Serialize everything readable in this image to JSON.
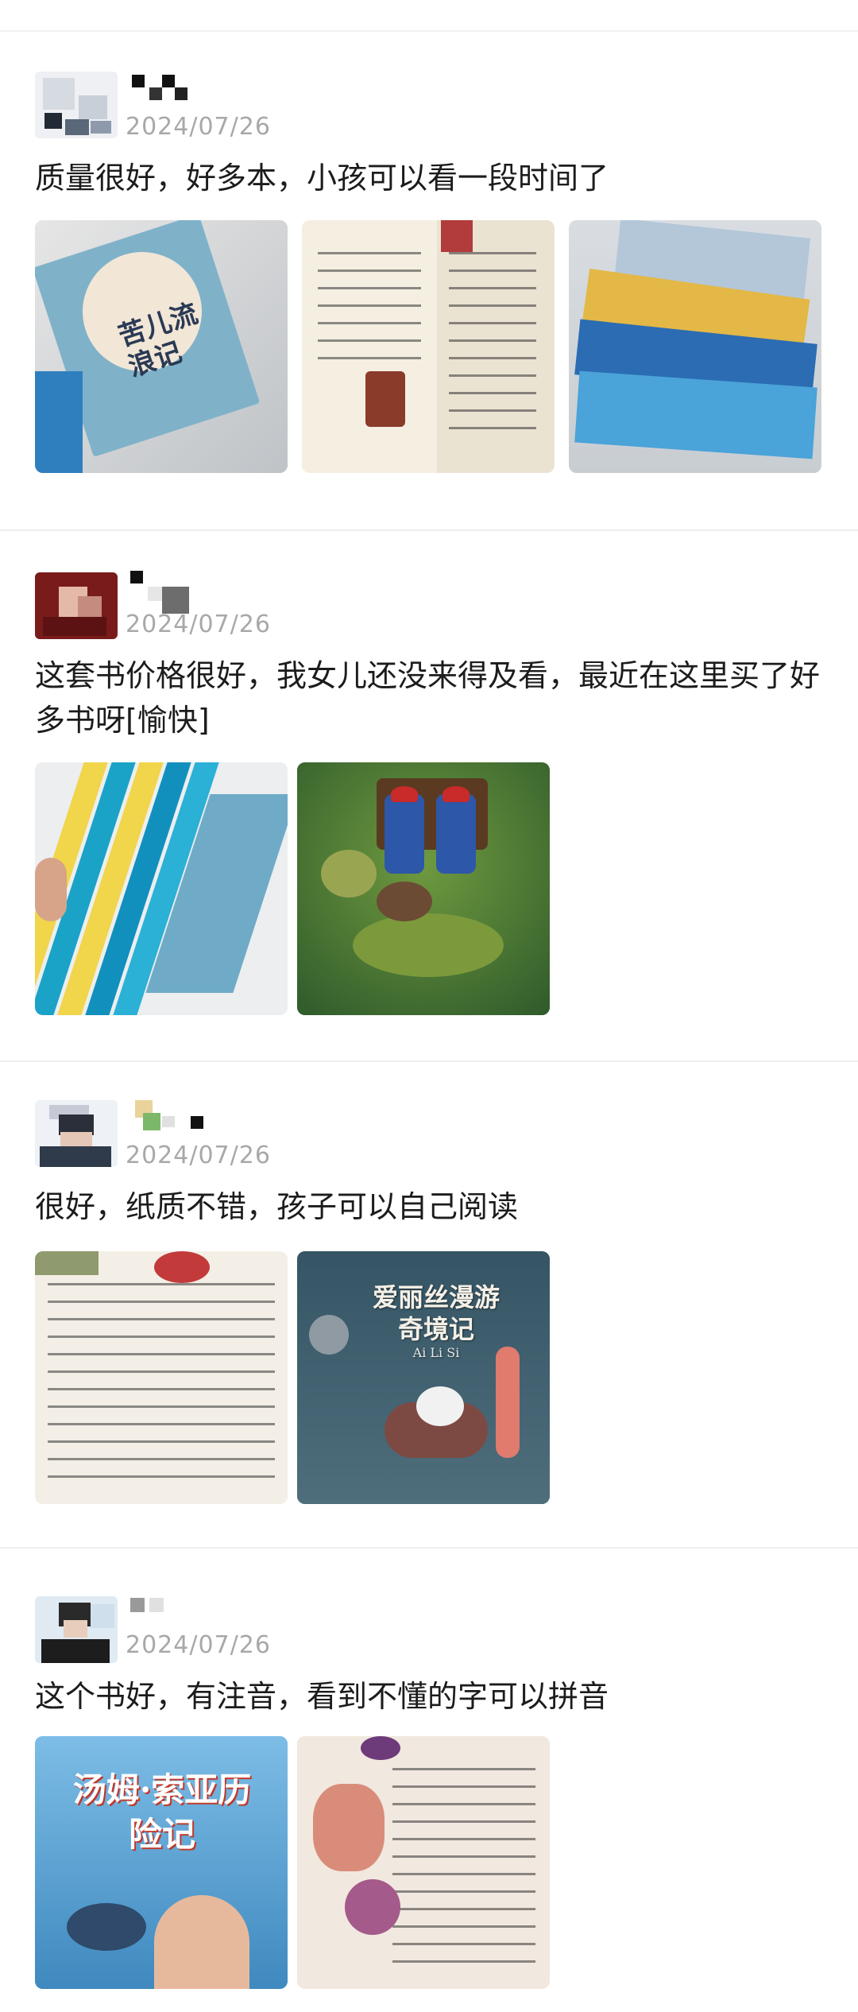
{
  "reviews": [
    {
      "date": "2024/07/26",
      "text": "质量很好，好多本，小孩可以看一段时间了",
      "photos": [
        {
          "alt": "photo",
          "title": "苦儿流浪记"
        },
        {
          "alt": "photo",
          "title": ""
        },
        {
          "alt": "photo",
          "title": ""
        }
      ]
    },
    {
      "date": "2024/07/26",
      "text": "这套书价格很好，我女儿还没来得及看，最近在这里买了好多书呀[愉快]",
      "photos": [
        {
          "alt": "photo",
          "title": ""
        },
        {
          "alt": "photo",
          "title": ""
        }
      ]
    },
    {
      "date": "2024/07/26",
      "text": "很好，纸质不错，孩子可以自己阅读",
      "photos": [
        {
          "alt": "photo",
          "title": ""
        },
        {
          "alt": "photo",
          "title": "爱丽丝漫游奇境记",
          "subtitle": "Ai Li Si"
        }
      ]
    },
    {
      "date": "2024/07/26",
      "text": "这个书好，有注音，看到不懂的字可以拼音",
      "photos": [
        {
          "alt": "photo",
          "title": "汤姆·索亚历险记"
        },
        {
          "alt": "photo",
          "title": ""
        }
      ]
    }
  ],
  "colors": {
    "date": "#a8a8a8",
    "text": "#1c1c1c",
    "divider": "#eeeeee"
  }
}
